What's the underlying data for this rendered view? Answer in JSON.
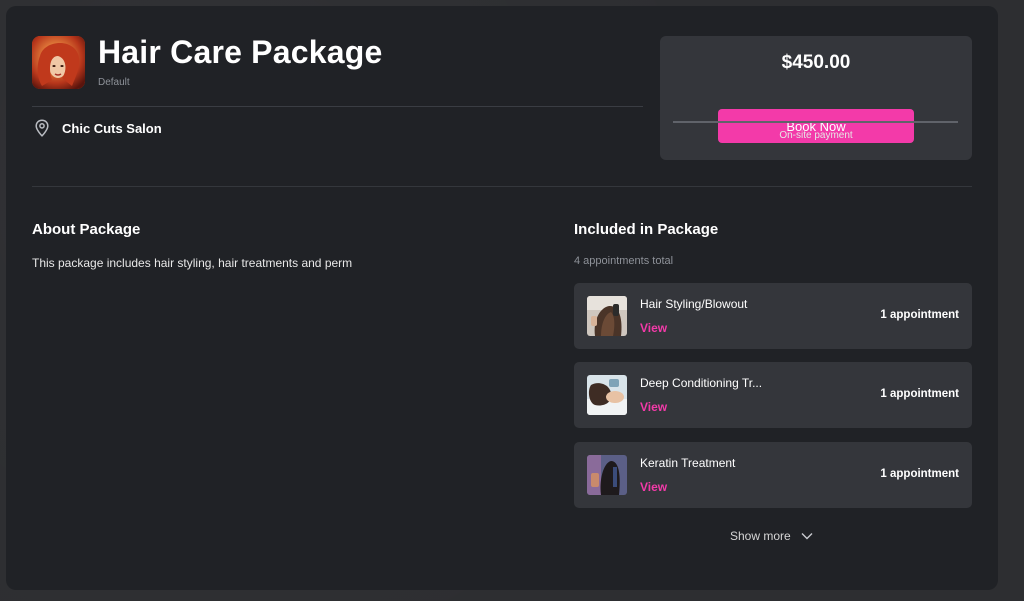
{
  "package": {
    "title": "Hair Care Package",
    "subtitle": "Default",
    "location": "Chic Cuts Salon",
    "logo_icon": "salon-logo-image"
  },
  "pricing": {
    "price": "$450.00",
    "book_label": "Book Now",
    "payment_note": "On-site payment",
    "accent_color": "#f33aa9"
  },
  "about": {
    "heading": "About Package",
    "text": "This package includes hair styling, hair treatments and perm"
  },
  "included": {
    "heading": "Included in Package",
    "count_text": "4 appointments total",
    "items": [
      {
        "name": "Hair Styling/Blowout",
        "action": "View",
        "quantity": "1 appointment",
        "thumb_icon": "hair-styling-thumbnail"
      },
      {
        "name": "Deep Conditioning Tr...",
        "action": "View",
        "quantity": "1 appointment",
        "thumb_icon": "conditioning-thumbnail"
      },
      {
        "name": "Keratin Treatment",
        "action": "View",
        "quantity": "1 appointment",
        "thumb_icon": "keratin-thumbnail"
      }
    ],
    "show_more_label": "Show more"
  }
}
